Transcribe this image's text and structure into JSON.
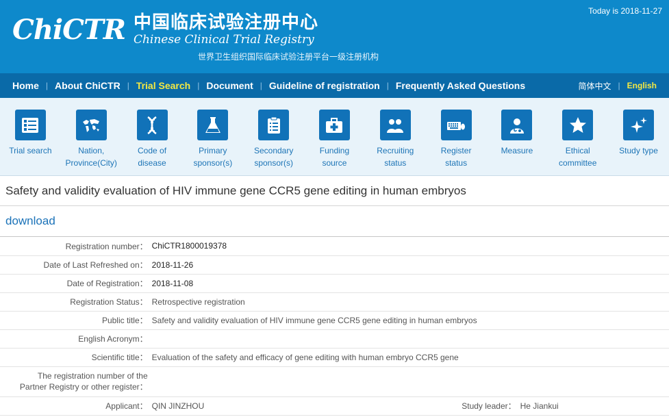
{
  "header": {
    "logo_mark": "ChiCTR",
    "logo_cn": "中国临床试验注册中心",
    "logo_en": "Chinese Clinical Trial Registry",
    "subtitle": "世界卫生组织国际临床试验注册平台一级注册机构",
    "today": "Today is 2018-11-27"
  },
  "nav": {
    "items": [
      "Home",
      "About ChiCTR",
      "Trial Search",
      "Document",
      "Guideline of registration",
      "Frequently Asked Questions"
    ],
    "active": "Trial Search",
    "lang_cn": "简体中文",
    "lang_en": "English"
  },
  "icons": [
    {
      "name": "list-icon",
      "line1": "Trial search",
      "line2": ""
    },
    {
      "name": "world-map-icon",
      "line1": "Nation,",
      "line2": "Province(City)"
    },
    {
      "name": "dna-icon",
      "line1": "Code of",
      "line2": "disease"
    },
    {
      "name": "flask-icon",
      "line1": "Primary",
      "line2": "sponsor(s)"
    },
    {
      "name": "clipboard-icon",
      "line1": "Secondary",
      "line2": "sponsor(s)"
    },
    {
      "name": "medical-kit-icon",
      "line1": "Funding",
      "line2": "source"
    },
    {
      "name": "people-icon",
      "line1": "Recruiting",
      "line2": "status"
    },
    {
      "name": "keyboard-icon",
      "line1": "Register",
      "line2": "status"
    },
    {
      "name": "doctor-icon",
      "line1": "Measure",
      "line2": ""
    },
    {
      "name": "star-icon",
      "line1": "Ethical",
      "line2": "committee"
    },
    {
      "name": "sparkle-icon",
      "line1": "Study type",
      "line2": ""
    }
  ],
  "page": {
    "title": "Safety and validity evaluation of HIV immune gene CCR5 gene editing in human embryos",
    "download": "download"
  },
  "details": {
    "registration_number_label": "Registration number：",
    "registration_number": "ChiCTR1800019378",
    "last_refreshed_label": "Date of Last Refreshed on：",
    "last_refreshed": "2018-11-26",
    "date_registration_label": "Date of Registration：",
    "date_registration": "2018-11-08",
    "status_label": "Registration Status：",
    "status": "Retrospective registration",
    "public_title_label": "Public title：",
    "public_title": "Safety and validity evaluation of HIV immune gene CCR5 gene editing in human embryos",
    "acronym_label": "English Acronym：",
    "acronym": "",
    "scientific_title_label": "Scientific title：",
    "scientific_title": "Evaluation of the safety and efficacy of gene editing with human embryo CCR5 gene",
    "partner_label_1": "The registration number of the",
    "partner_label_2": "Partner Registry or other register：",
    "partner_value": "",
    "applicant_label": "Applicant：",
    "applicant": "QIN JINZHOU",
    "study_leader_label": "Study leader：",
    "study_leader": "He Jiankui"
  },
  "colors": {
    "header_blue": "#0e89cb",
    "nav_blue": "#0a6aa8",
    "active_yellow": "#f5e942",
    "icon_blue": "#1172b8",
    "link_blue": "#1a72b8"
  }
}
